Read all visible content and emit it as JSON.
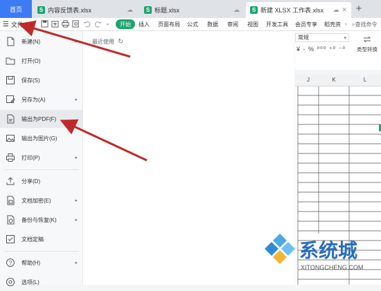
{
  "tabs": {
    "home": "首页",
    "items": [
      {
        "title": "内容反馈表.xlsx",
        "icon": "S"
      },
      {
        "title": "标题.xlsx",
        "icon": "S"
      },
      {
        "title": "新建 XLSX 工作表.xlsx",
        "icon": "S"
      }
    ],
    "new_tab": "+"
  },
  "ribbon": {
    "menu_label": "文件",
    "start": "开始",
    "tabs": [
      "插入",
      "页面布局",
      "公式",
      "数据",
      "审阅",
      "视图",
      "开发工具",
      "会员专享",
      "稻壳资"
    ],
    "more": "›",
    "search": "查找命令"
  },
  "format": {
    "number_format": "常规",
    "number_buttons": "¥ - % ⁰⁰⁰ ⁺⁰ ⁻⁰",
    "convert_label": "类型转换"
  },
  "grid": {
    "columns": [
      "J",
      "K",
      "L"
    ]
  },
  "file_menu": {
    "items": [
      {
        "label": "新建(N)",
        "icon": "new-file-icon",
        "chevron": true
      },
      {
        "label": "打开(O)",
        "icon": "folder-icon",
        "chevron": false
      },
      {
        "label": "保存(S)",
        "icon": "save-icon",
        "chevron": false
      },
      {
        "label": "另存为(A)",
        "icon": "save-as-icon",
        "chevron": true
      },
      {
        "label": "输出为PDF(F)",
        "icon": "pdf-export-icon",
        "chevron": false
      },
      {
        "label": "输出为图片(G)",
        "icon": "image-export-icon",
        "chevron": false
      },
      {
        "label": "打印(P)",
        "icon": "print-icon",
        "chevron": true
      },
      {
        "label": "分享(D)",
        "icon": "share-icon",
        "chevron": false
      },
      {
        "label": "文档加密(E)",
        "icon": "encrypt-icon",
        "chevron": true
      },
      {
        "label": "备份与恢复(K)",
        "icon": "backup-icon",
        "chevron": true
      },
      {
        "label": "文档定稿",
        "icon": "finalize-icon",
        "chevron": false
      },
      {
        "label": "帮助(H)",
        "icon": "help-icon",
        "chevron": true
      },
      {
        "label": "选项(L)",
        "icon": "options-icon",
        "chevron": false
      }
    ]
  },
  "recent": {
    "label": "最近使用"
  },
  "watermark": {
    "brand": "系统城",
    "url": "XITONGCHENG.COM"
  },
  "colors": {
    "accent": "#3d7bf5",
    "green": "#1aa56e",
    "arrow": "#c0292b"
  }
}
